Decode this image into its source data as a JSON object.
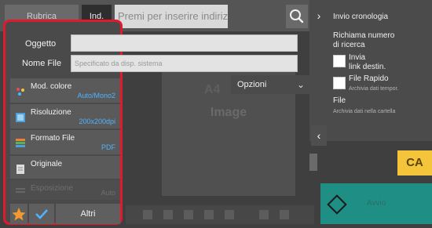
{
  "topbar": {
    "tabs": [
      "Rubrica",
      "Ind."
    ],
    "address_placeholder": "Premi per inserire indirizzo"
  },
  "preview": {
    "paper_size": "A4",
    "image_label": "Image",
    "options_label": "Opzioni"
  },
  "left_panel": {
    "fields": [
      {
        "label": "Oggetto",
        "value": ""
      },
      {
        "label": "Nome File",
        "placeholder": "Specificato da disp. sistema"
      }
    ],
    "options": [
      {
        "title": "Mod. colore",
        "value": "Auto/Mono2",
        "icon": "color-mode-icon",
        "enabled": true
      },
      {
        "title": "Risoluzione",
        "value": "200x200dpi",
        "icon": "resolution-icon",
        "enabled": true
      },
      {
        "title": "Formato File",
        "value": "PDF",
        "icon": "file-format-icon",
        "enabled": true
      },
      {
        "title": "Originale",
        "value": "",
        "icon": "original-icon",
        "enabled": true
      },
      {
        "title": "Esposizione",
        "value": "Auto",
        "icon": "exposure-icon",
        "enabled": false
      }
    ],
    "bottom": {
      "favorite_icon": "star-icon",
      "check_icon": "checkmark-icon",
      "others_label": "Altri"
    },
    "highlight_color": "#e0192c"
  },
  "right_panel": {
    "items": [
      {
        "label": "Invio cronologia"
      },
      {
        "label": "Richiama numero\ndi ricerca"
      },
      {
        "label": "Invia\nlink destin.",
        "checkbox": true
      },
      {
        "label": "File Rapido",
        "sub": "Archivia dati tempor.",
        "checkbox": true
      },
      {
        "label": "File",
        "sub": "Archivia dati nella cartella"
      }
    ]
  },
  "actions": {
    "ca_label": "CA",
    "start_label": "Avvio",
    "ca_color": "#f4c43a",
    "start_color": "#1f8f86"
  }
}
